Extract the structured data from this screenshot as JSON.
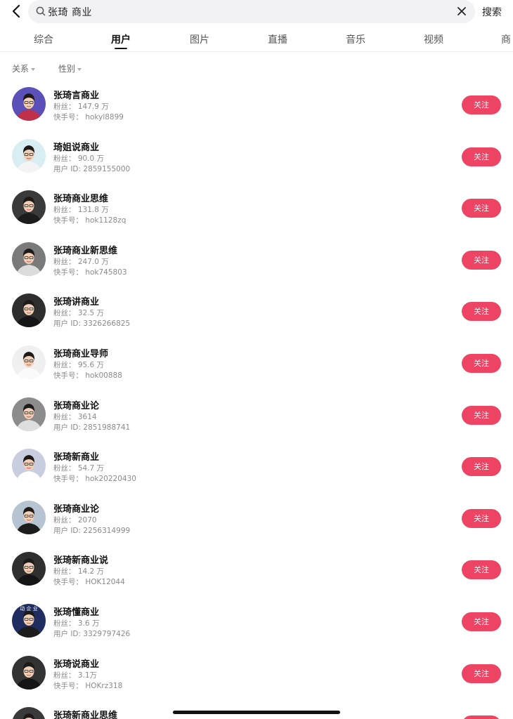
{
  "search": {
    "query": "张琦 商业",
    "submit_label": "搜索",
    "back_icon": "chevron-left-icon",
    "clear_icon": "close-icon"
  },
  "tabs": [
    {
      "label": "综合"
    },
    {
      "label": "用户",
      "active": true
    },
    {
      "label": "图片"
    },
    {
      "label": "直播"
    },
    {
      "label": "音乐"
    },
    {
      "label": "视频"
    },
    {
      "label": "商"
    }
  ],
  "filters": [
    {
      "label": "关系"
    },
    {
      "label": "性别"
    }
  ],
  "colors": {
    "accent": "#ee4463",
    "text_primary": "#111111",
    "text_secondary": "#8a8a8a",
    "search_bg": "#f2f2f4"
  },
  "follow_label": "关注",
  "users": [
    {
      "name": "张琦言商业",
      "fans": "粉丝：  147.9 万",
      "id": "快手号：  hokyl8899",
      "avatar": {
        "bg": "#5b4fb8",
        "shirt": "#c0304a"
      }
    },
    {
      "name": "琦姐说商业",
      "fans": "粉丝：  90.0 万",
      "id": "用户 ID: 2859155000",
      "avatar": {
        "bg": "#d9eef3",
        "shirt": "#f4f4f4"
      }
    },
    {
      "name": "张琦商业思维",
      "fans": "粉丝：  131.8 万",
      "id": "快手号：  hok1128zq",
      "avatar": {
        "bg": "#3a3a3a",
        "shirt": "#1c1c1c"
      }
    },
    {
      "name": "张琦商业新思维",
      "fans": "粉丝：  247.0 万",
      "id": "快手号：  hok745803",
      "avatar": {
        "bg": "#7a7a7a",
        "shirt": "#dcdcdc"
      }
    },
    {
      "name": "张琦讲商业",
      "fans": "粉丝：  32.5 万",
      "id": "用户 ID: 3326266825",
      "avatar": {
        "bg": "#2e2e2e",
        "shirt": "#151515"
      }
    },
    {
      "name": "张琦商业导师",
      "fans": "粉丝：  95.6 万",
      "id": "快手号：  hok00888",
      "avatar": {
        "bg": "#f0f0f0",
        "shirt": "#fafafa"
      }
    },
    {
      "name": "张琦商业论",
      "fans": "粉丝：  3614",
      "id": "用户 ID: 2851988741",
      "avatar": {
        "bg": "#8c8c8c",
        "shirt": "#dedede"
      }
    },
    {
      "name": "张琦新商业",
      "fans": "粉丝：  54.7 万",
      "id": "快手号：  hok20220430",
      "avatar": {
        "bg": "#c9cde0",
        "shirt": "#ffffff"
      }
    },
    {
      "name": "张琦商业论",
      "fans": "粉丝：  2070",
      "id": "用户 ID: 2256314999",
      "avatar": {
        "bg": "#b6c4d2",
        "shirt": "#1c1c1c"
      }
    },
    {
      "name": "张琦新商业说",
      "fans": "粉丝：  14.2 万",
      "id": "快手号：  HOK12044",
      "avatar": {
        "bg": "#2f2f2f",
        "shirt": "#141414"
      }
    },
    {
      "name": "张琦懂商业",
      "fans": "粉丝：  3.6 万",
      "id": "用户 ID: 3329797426",
      "avatar": {
        "bg": "#1f2e5e",
        "shirt": "#1c1c1c",
        "caption": "动 企 业"
      }
    },
    {
      "name": "张琦说商业",
      "fans": "粉丝：  3.1万",
      "id": "快手号：  HOKrz318",
      "avatar": {
        "bg": "#333333",
        "shirt": "#151515"
      }
    },
    {
      "name": "张琦新商业思维",
      "fans": "",
      "id": "",
      "avatar": {
        "bg": "#3a3a3a",
        "shirt": "#151515"
      }
    }
  ]
}
